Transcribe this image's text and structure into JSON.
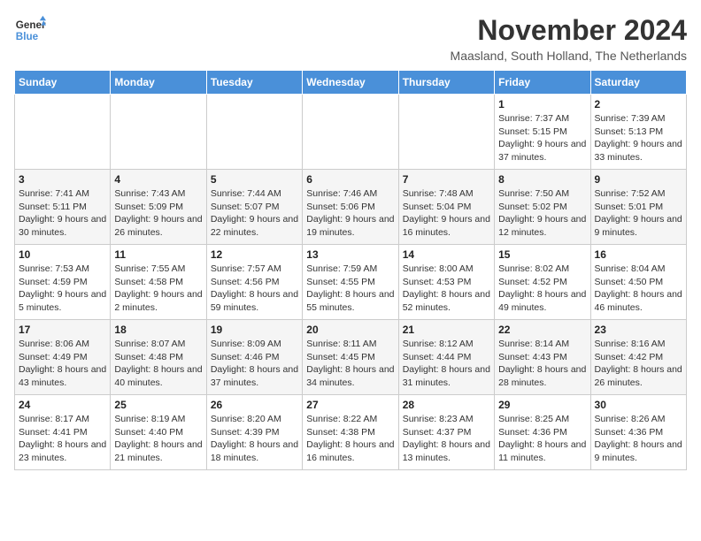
{
  "header": {
    "logo_line1": "General",
    "logo_line2": "Blue",
    "month_title": "November 2024",
    "subtitle": "Maasland, South Holland, The Netherlands"
  },
  "weekdays": [
    "Sunday",
    "Monday",
    "Tuesday",
    "Wednesday",
    "Thursday",
    "Friday",
    "Saturday"
  ],
  "weeks": [
    [
      {
        "day": "",
        "info": ""
      },
      {
        "day": "",
        "info": ""
      },
      {
        "day": "",
        "info": ""
      },
      {
        "day": "",
        "info": ""
      },
      {
        "day": "",
        "info": ""
      },
      {
        "day": "1",
        "info": "Sunrise: 7:37 AM\nSunset: 5:15 PM\nDaylight: 9 hours and 37 minutes."
      },
      {
        "day": "2",
        "info": "Sunrise: 7:39 AM\nSunset: 5:13 PM\nDaylight: 9 hours and 33 minutes."
      }
    ],
    [
      {
        "day": "3",
        "info": "Sunrise: 7:41 AM\nSunset: 5:11 PM\nDaylight: 9 hours and 30 minutes."
      },
      {
        "day": "4",
        "info": "Sunrise: 7:43 AM\nSunset: 5:09 PM\nDaylight: 9 hours and 26 minutes."
      },
      {
        "day": "5",
        "info": "Sunrise: 7:44 AM\nSunset: 5:07 PM\nDaylight: 9 hours and 22 minutes."
      },
      {
        "day": "6",
        "info": "Sunrise: 7:46 AM\nSunset: 5:06 PM\nDaylight: 9 hours and 19 minutes."
      },
      {
        "day": "7",
        "info": "Sunrise: 7:48 AM\nSunset: 5:04 PM\nDaylight: 9 hours and 16 minutes."
      },
      {
        "day": "8",
        "info": "Sunrise: 7:50 AM\nSunset: 5:02 PM\nDaylight: 9 hours and 12 minutes."
      },
      {
        "day": "9",
        "info": "Sunrise: 7:52 AM\nSunset: 5:01 PM\nDaylight: 9 hours and 9 minutes."
      }
    ],
    [
      {
        "day": "10",
        "info": "Sunrise: 7:53 AM\nSunset: 4:59 PM\nDaylight: 9 hours and 5 minutes."
      },
      {
        "day": "11",
        "info": "Sunrise: 7:55 AM\nSunset: 4:58 PM\nDaylight: 9 hours and 2 minutes."
      },
      {
        "day": "12",
        "info": "Sunrise: 7:57 AM\nSunset: 4:56 PM\nDaylight: 8 hours and 59 minutes."
      },
      {
        "day": "13",
        "info": "Sunrise: 7:59 AM\nSunset: 4:55 PM\nDaylight: 8 hours and 55 minutes."
      },
      {
        "day": "14",
        "info": "Sunrise: 8:00 AM\nSunset: 4:53 PM\nDaylight: 8 hours and 52 minutes."
      },
      {
        "day": "15",
        "info": "Sunrise: 8:02 AM\nSunset: 4:52 PM\nDaylight: 8 hours and 49 minutes."
      },
      {
        "day": "16",
        "info": "Sunrise: 8:04 AM\nSunset: 4:50 PM\nDaylight: 8 hours and 46 minutes."
      }
    ],
    [
      {
        "day": "17",
        "info": "Sunrise: 8:06 AM\nSunset: 4:49 PM\nDaylight: 8 hours and 43 minutes."
      },
      {
        "day": "18",
        "info": "Sunrise: 8:07 AM\nSunset: 4:48 PM\nDaylight: 8 hours and 40 minutes."
      },
      {
        "day": "19",
        "info": "Sunrise: 8:09 AM\nSunset: 4:46 PM\nDaylight: 8 hours and 37 minutes."
      },
      {
        "day": "20",
        "info": "Sunrise: 8:11 AM\nSunset: 4:45 PM\nDaylight: 8 hours and 34 minutes."
      },
      {
        "day": "21",
        "info": "Sunrise: 8:12 AM\nSunset: 4:44 PM\nDaylight: 8 hours and 31 minutes."
      },
      {
        "day": "22",
        "info": "Sunrise: 8:14 AM\nSunset: 4:43 PM\nDaylight: 8 hours and 28 minutes."
      },
      {
        "day": "23",
        "info": "Sunrise: 8:16 AM\nSunset: 4:42 PM\nDaylight: 8 hours and 26 minutes."
      }
    ],
    [
      {
        "day": "24",
        "info": "Sunrise: 8:17 AM\nSunset: 4:41 PM\nDaylight: 8 hours and 23 minutes."
      },
      {
        "day": "25",
        "info": "Sunrise: 8:19 AM\nSunset: 4:40 PM\nDaylight: 8 hours and 21 minutes."
      },
      {
        "day": "26",
        "info": "Sunrise: 8:20 AM\nSunset: 4:39 PM\nDaylight: 8 hours and 18 minutes."
      },
      {
        "day": "27",
        "info": "Sunrise: 8:22 AM\nSunset: 4:38 PM\nDaylight: 8 hours and 16 minutes."
      },
      {
        "day": "28",
        "info": "Sunrise: 8:23 AM\nSunset: 4:37 PM\nDaylight: 8 hours and 13 minutes."
      },
      {
        "day": "29",
        "info": "Sunrise: 8:25 AM\nSunset: 4:36 PM\nDaylight: 8 hours and 11 minutes."
      },
      {
        "day": "30",
        "info": "Sunrise: 8:26 AM\nSunset: 4:36 PM\nDaylight: 8 hours and 9 minutes."
      }
    ]
  ]
}
